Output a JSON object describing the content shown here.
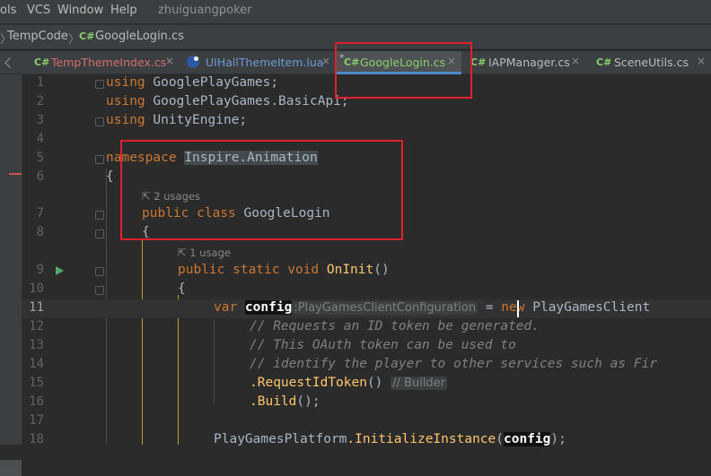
{
  "menu": {
    "items": [
      "ols",
      "VCS",
      "Window",
      "Help"
    ],
    "project": "zhuiguangpoker"
  },
  "nav": {
    "folder": "TempCode",
    "sep": "〉",
    "file_type": "C#",
    "file": "GoogleLogin.cs"
  },
  "tabs": [
    {
      "type": "C#",
      "label": "TempThemeIndex.cs",
      "color": "#d56d6d"
    },
    {
      "type": "lua",
      "label": "UIHallThemeItem.lua",
      "color": "#6c9bd4"
    },
    {
      "type": "C#",
      "label": "GoogleLogin.cs",
      "modified": "*",
      "active": true
    },
    {
      "type": "C#",
      "label": "IAPManager.cs"
    },
    {
      "type": "C#",
      "label": "SceneUtils.cs"
    }
  ],
  "close_glyph": "×",
  "editor": {
    "line_numbers": [
      "1",
      "2",
      "3",
      "4",
      "5",
      "6",
      "7",
      "8",
      "9",
      "10",
      "11",
      "12",
      "13",
      "14",
      "15",
      "16",
      "17",
      "18"
    ],
    "usages": {
      "class": "2 usages",
      "method": "1 usage"
    },
    "code": {
      "l1_kw": "using",
      "l1_rest": " GooglePlayGames;",
      "l2_kw": "using",
      "l2_rest": " GooglePlayGames.BasicApi;",
      "l3_kw": "using",
      "l3_rest": " UnityEngine;",
      "l5_kw": "namespace",
      "l5_ns": "Inspire.Animation",
      "l6": "{",
      "l7_kw": "public class",
      "l7_cls": " GoogleLogin",
      "l8": "{",
      "l9_kw": "public static void",
      "l9_fn": " OnInit",
      "l9_rest": "()",
      "l10": "{",
      "l11_kw": "var",
      "l11_var": "config",
      "l11_hint": ":PlayGamesClientConfiguration",
      "l11_eq": " = ",
      "l11_new": "new",
      "l11_cls": " PlayGamesClient",
      "l12": "// Requests an ID token be generated.",
      "l13": "// This OAuth token can be used to",
      "l14": "// identify the player to other services such as Fir",
      "l15_fn": ".RequestIdToken",
      "l15_rest": "()",
      "l15_hint": "// Builder",
      "l16_fn": ".Build",
      "l16_rest": "();",
      "l18_cls": "PlayGamesPlatform",
      "l18_fn": ".InitializeInstance",
      "l18_open": "(",
      "l18_arg": "config",
      "l18_close": ");"
    }
  }
}
